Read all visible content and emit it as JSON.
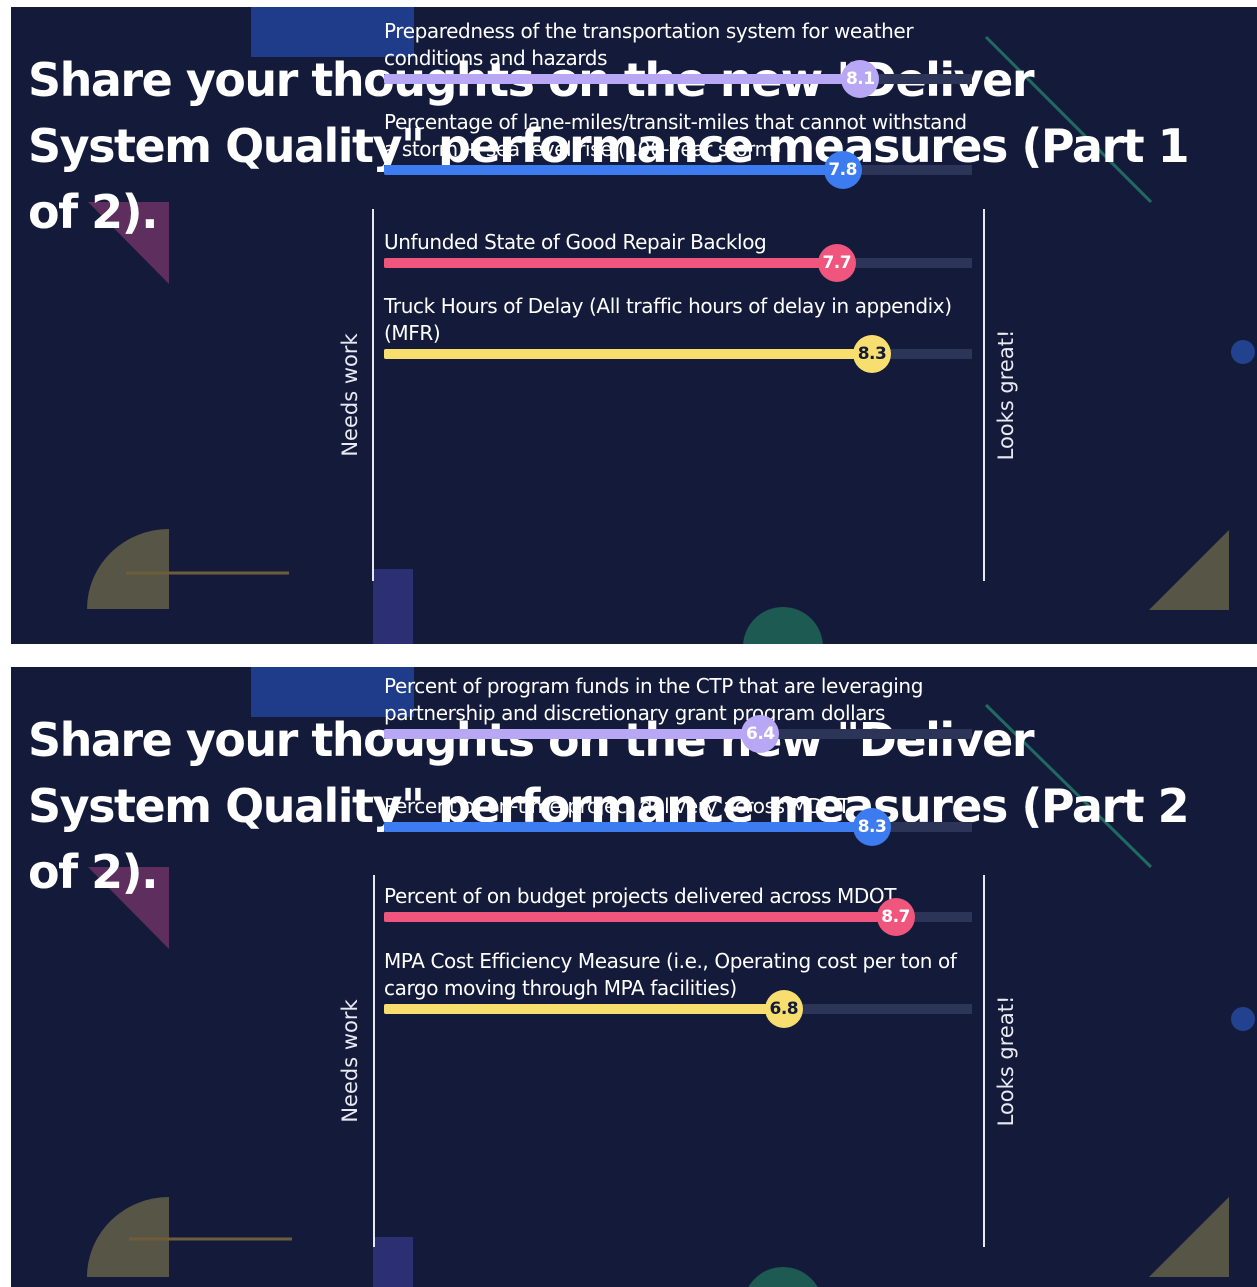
{
  "scale": {
    "min_label": "Needs work",
    "max_label": "Looks great!",
    "max": 10
  },
  "colors": {
    "background": "#141b3a",
    "purple": "#b8a7f5",
    "blue": "#3d7cf0",
    "pink": "#f0557d",
    "yellow": "#f7de6e"
  },
  "slides": [
    {
      "title": "Share your thoughts on the new \"Deliver System Quality\" performance measures (Part 1 of 2)."
    },
    {
      "title": "Share your thoughts on the new \"Deliver System Quality\" performance measures (Part 2 of 2)."
    }
  ],
  "chart_data": [
    {
      "type": "bar",
      "categories": [
        "Preparedness of the transportation system for weather conditions and hazards",
        "Percentage of lane-miles/transit-miles that cannot withstand a storm + sea level rise (100-year storm)",
        "Unfunded State of Good Repair Backlog",
        "Truck Hours of Delay (All traffic hours of delay in appendix) (MFR)"
      ],
      "values": [
        8.1,
        7.8,
        7.7,
        8.3
      ],
      "value_labels": [
        "8.1",
        "7.8",
        "7.7",
        "8.3"
      ],
      "series_colors": [
        "#b8a7f5",
        "#3d7cf0",
        "#f0557d",
        "#f7de6e"
      ],
      "xlim": [
        0,
        10
      ],
      "xlabel_min": "Needs work",
      "xlabel_max": "Looks great!"
    },
    {
      "type": "bar",
      "categories": [
        "Percent of program funds in the CTP that are leveraging partnership and discretionary grant program dollars",
        "Percent of on-time project delivery across MDOT",
        "Percent of on budget projects delivered across MDOT",
        "MPA Cost Efficiency Measure (i.e., Operating cost per ton of cargo moving through MPA facilities)"
      ],
      "values": [
        6.4,
        8.3,
        8.7,
        6.8
      ],
      "value_labels": [
        "6.4",
        "8.3",
        "8.7",
        "6.8"
      ],
      "series_colors": [
        "#b8a7f5",
        "#3d7cf0",
        "#f0557d",
        "#f7de6e"
      ],
      "xlim": [
        0,
        10
      ],
      "xlabel_min": "Needs work",
      "xlabel_max": "Looks great!"
    }
  ]
}
